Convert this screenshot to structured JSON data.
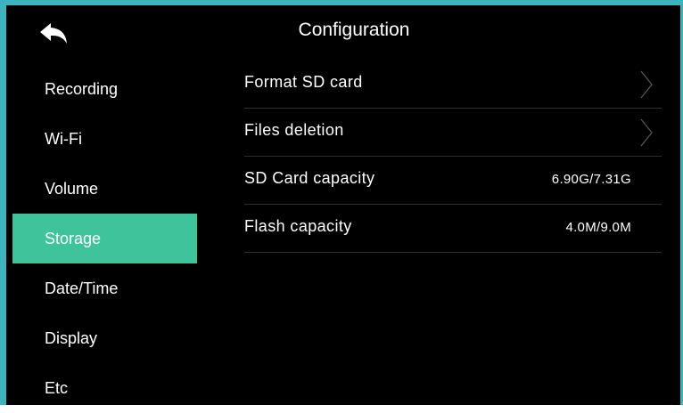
{
  "header": {
    "title": "Configuration",
    "back_icon": "back-arrow-icon"
  },
  "sidebar": {
    "items": [
      {
        "label": "Recording"
      },
      {
        "label": "Wi-Fi"
      },
      {
        "label": "Volume"
      },
      {
        "label": "Storage",
        "selected": true
      },
      {
        "label": "Date/Time"
      },
      {
        "label": "Display"
      },
      {
        "label": "Etc"
      }
    ]
  },
  "storage": {
    "rows": [
      {
        "label": "Format SD card",
        "icon": "chevron-right-icon"
      },
      {
        "label": "Files deletion",
        "icon": "chevron-right-icon"
      },
      {
        "label": "SD Card capacity",
        "value": "6.90G/7.31G"
      },
      {
        "label": "Flash capacity",
        "value": "4.0M/9.0M"
      }
    ]
  },
  "colors": {
    "frame": "#3cb4bf",
    "selected": "#3ec39a",
    "background": "#000000"
  }
}
